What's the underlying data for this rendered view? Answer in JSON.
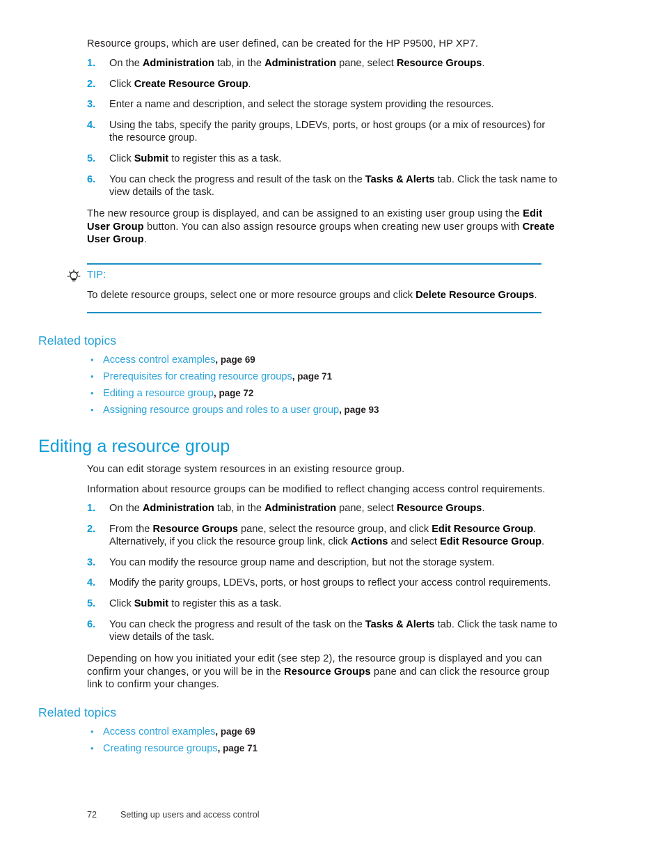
{
  "page": {
    "number": "72",
    "footer_text": "Setting up users and access control"
  },
  "creating_section": {
    "intro": "Resource groups, which are user defined, can be created for the HP P9500, HP XP7.",
    "steps": [
      {
        "num": "1.",
        "html": "On the <b>Administration</b> tab, in the <b>Administration</b> pane, select <b>Resource Groups</b>."
      },
      {
        "num": "2.",
        "html": "Click <b>Create Resource Group</b>."
      },
      {
        "num": "3.",
        "html": "Enter a name and description, and select the storage system providing the resources."
      },
      {
        "num": "4.",
        "html": "Using the tabs, specify the parity groups, LDEVs, ports, or host groups (or a mix of resources) for the resource group."
      },
      {
        "num": "5.",
        "html": "Click <b>Submit</b> to register this as a task."
      },
      {
        "num": "6.",
        "html": "You can check the progress and result of the task on the <b>Tasks &amp; Alerts</b> tab. Click the task name to view details of the task."
      }
    ],
    "closing_html": "The new resource group is displayed, and can be assigned to an existing user group using the <b>Edit User Group</b> button. You can also assign resource groups when creating new user groups with <b>Create User Group</b>."
  },
  "tip": {
    "icon": "lightbulb-icon",
    "label": "TIP:",
    "body_html": "To delete resource groups, select one or more resource groups and click <b>Delete Resource Groups</b>."
  },
  "related_topics_1": {
    "title": "Related topics",
    "items": [
      {
        "link": "Access control examples",
        "page": ", page 69"
      },
      {
        "link": "Prerequisites for creating resource groups",
        "page": ", page 71"
      },
      {
        "link": "Editing a resource group",
        "page": ", page 72"
      },
      {
        "link": "Assigning resource groups and roles to a user group",
        "page": ", page 93"
      }
    ]
  },
  "editing_section": {
    "title": "Editing a resource group",
    "para1": "You can edit storage system resources in an existing resource group.",
    "para2": "Information about resource groups can be modified to reflect changing access control requirements.",
    "steps": [
      {
        "num": "1.",
        "html": "On the <b>Administration</b> tab, in the <b>Administration</b> pane, select <b>Resource Groups</b>."
      },
      {
        "num": "2.",
        "html": "From the <b>Resource Groups</b> pane, select the resource group, and click <b>Edit Resource Group</b>. Alternatively, if you click the resource group link, click <b>Actions</b> and select <b>Edit Resource Group</b>."
      },
      {
        "num": "3.",
        "html": "You can modify the resource group name and description, but not the storage system."
      },
      {
        "num": "4.",
        "html": "Modify the parity groups, LDEVs, ports, or host groups to reflect your access control requirements."
      },
      {
        "num": "5.",
        "html": "Click <b>Submit</b> to register this as a task."
      },
      {
        "num": "6.",
        "html": "You can check the progress and result of the task on the <b>Tasks &amp; Alerts</b> tab. Click the task name to view details of the task."
      }
    ],
    "closing_html": "Depending on how you initiated your edit (see step 2), the resource group is displayed and you can confirm your changes, or you will be in the <b>Resource Groups</b> pane and can click the resource group link to confirm your changes."
  },
  "related_topics_2": {
    "title": "Related topics",
    "items": [
      {
        "link": "Access control examples",
        "page": ", page 69"
      },
      {
        "link": "Creating resource groups",
        "page": ", page 71"
      }
    ]
  },
  "colors": {
    "heading_blue": "#0e9cd8",
    "link_blue": "#2ba3da",
    "step_number_blue": "#0f9ad7",
    "rule_blue": "#1b8fc4",
    "body_text": "#231f20"
  }
}
